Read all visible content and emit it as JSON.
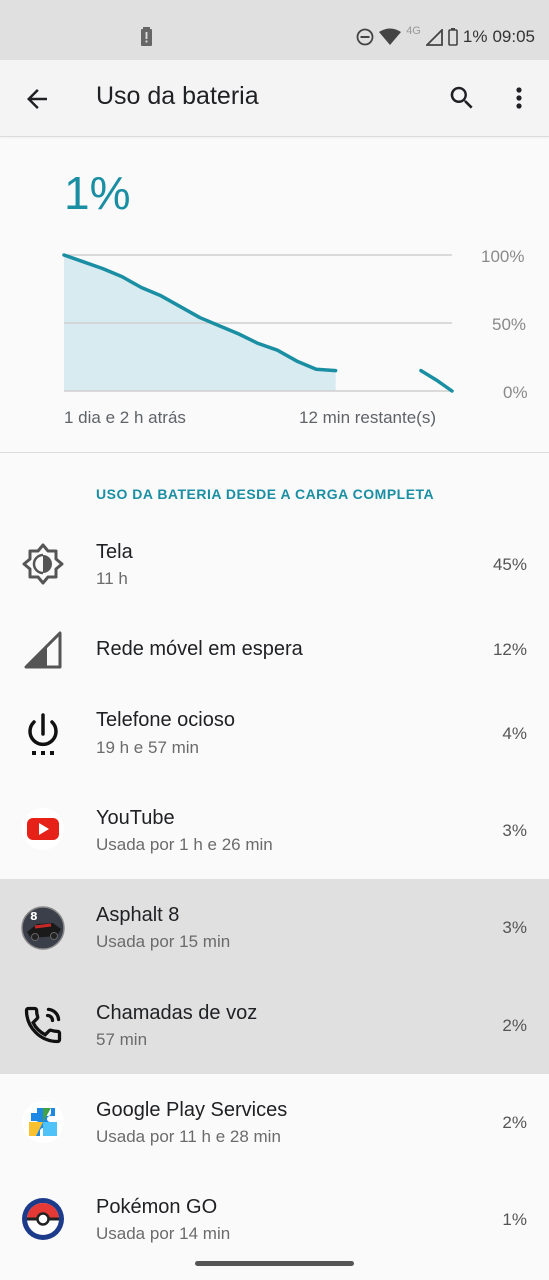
{
  "status_bar": {
    "battery_percent": "1%",
    "time": "09:05",
    "network": "4G",
    "icons": [
      "battery-alert-icon",
      "dnd-icon",
      "wifi-icon",
      "signal-icon",
      "battery-icon"
    ]
  },
  "app_bar": {
    "title": "Uso da bateria",
    "icons": [
      "back-arrow-icon",
      "search-icon",
      "more-vert-icon"
    ]
  },
  "summary": {
    "percent": "1%",
    "y_ticks": [
      "100%",
      "50%",
      "0%"
    ],
    "x_start": "1 dia e 2 h atrás",
    "x_end": "12 min restante(s)"
  },
  "chart_data": {
    "type": "line",
    "x_labels": [
      "1 dia e 2 h atrás",
      "12 min restante(s)"
    ],
    "ylim": [
      0,
      100
    ],
    "y_ticks": [
      "100%",
      "50%",
      "0%"
    ],
    "grid": true,
    "series": [
      {
        "role": "history",
        "x": [
          0.0,
          0.05,
          0.1,
          0.15,
          0.2,
          0.25,
          0.3,
          0.35,
          0.4,
          0.45,
          0.5,
          0.55,
          0.6,
          0.65,
          0.7
        ],
        "y": [
          100,
          95,
          90,
          84,
          76,
          70,
          62,
          54,
          48,
          42,
          35,
          30,
          22,
          16,
          15
        ]
      },
      {
        "role": "projection",
        "x": [
          0.92,
          0.96,
          1.0
        ],
        "y": [
          15,
          8,
          0
        ]
      }
    ],
    "colors": {
      "line": "#1a8ea2",
      "fill": "#cfe7ee"
    }
  },
  "section_header": "USO DA BATERIA DESDE A CARGA COMPLETA",
  "items": [
    {
      "name": "Tela",
      "sub": "11 h",
      "pct": "45%",
      "icon": "brightness-icon",
      "highlighted": false
    },
    {
      "name": "Rede móvel em espera",
      "sub": "",
      "pct": "12%",
      "icon": "cell-signal-icon",
      "highlighted": false
    },
    {
      "name": "Telefone ocioso",
      "sub": "19 h e 57 min",
      "pct": "4%",
      "icon": "power-idle-icon",
      "highlighted": false
    },
    {
      "name": "YouTube",
      "sub": "Usada por 1 h e 26 min",
      "pct": "3%",
      "icon": "youtube-icon",
      "highlighted": false
    },
    {
      "name": "Asphalt 8",
      "sub": "Usada por 15 min",
      "pct": "3%",
      "icon": "asphalt-8-icon",
      "highlighted": true
    },
    {
      "name": "Chamadas de voz",
      "sub": "57 min",
      "pct": "2%",
      "icon": "phone-call-icon",
      "highlighted": true
    },
    {
      "name": "Google Play Services",
      "sub": "Usada por 11 h e 28 min",
      "pct": "2%",
      "icon": "play-services-icon",
      "highlighted": false
    },
    {
      "name": "Pokémon GO",
      "sub": "Usada por 14 min",
      "pct": "1%",
      "icon": "pokeball-icon",
      "highlighted": false
    }
  ],
  "colors": {
    "accent": "#1a8ea2",
    "highlight": "#e0e0e0",
    "background": "#fafafa"
  }
}
